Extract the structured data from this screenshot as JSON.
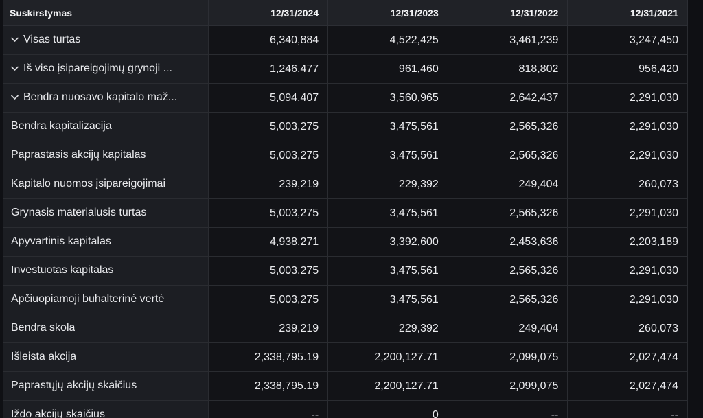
{
  "table": {
    "header": {
      "label": "Suskirstymas",
      "periods": [
        "12/31/2024",
        "12/31/2023",
        "12/31/2022",
        "12/31/2021"
      ]
    },
    "rows": [
      {
        "label": "Visas turtas",
        "expandable": true,
        "values": [
          "6,340,884",
          "4,522,425",
          "3,461,239",
          "3,247,450"
        ]
      },
      {
        "label": "Iš viso įsipareigojimų grynoji ...",
        "expandable": true,
        "values": [
          "1,246,477",
          "961,460",
          "818,802",
          "956,420"
        ]
      },
      {
        "label": "Bendra nuosavo kapitalo maž...",
        "expandable": true,
        "values": [
          "5,094,407",
          "3,560,965",
          "2,642,437",
          "2,291,030"
        ]
      },
      {
        "label": "Bendra kapitalizacija",
        "expandable": false,
        "values": [
          "5,003,275",
          "3,475,561",
          "2,565,326",
          "2,291,030"
        ]
      },
      {
        "label": "Paprastasis akcijų kapitalas",
        "expandable": false,
        "values": [
          "5,003,275",
          "3,475,561",
          "2,565,326",
          "2,291,030"
        ]
      },
      {
        "label": "Kapitalo nuomos įsipareigojimai",
        "expandable": false,
        "values": [
          "239,219",
          "229,392",
          "249,404",
          "260,073"
        ]
      },
      {
        "label": "Grynasis materialusis turtas",
        "expandable": false,
        "values": [
          "5,003,275",
          "3,475,561",
          "2,565,326",
          "2,291,030"
        ]
      },
      {
        "label": "Apyvartinis kapitalas",
        "expandable": false,
        "values": [
          "4,938,271",
          "3,392,600",
          "2,453,636",
          "2,203,189"
        ]
      },
      {
        "label": "Investuotas kapitalas",
        "expandable": false,
        "values": [
          "5,003,275",
          "3,475,561",
          "2,565,326",
          "2,291,030"
        ]
      },
      {
        "label": "Apčiuopiamoji buhalterinė vertė",
        "expandable": false,
        "values": [
          "5,003,275",
          "3,475,561",
          "2,565,326",
          "2,291,030"
        ]
      },
      {
        "label": "Bendra skola",
        "expandable": false,
        "values": [
          "239,219",
          "229,392",
          "249,404",
          "260,073"
        ]
      },
      {
        "label": "Išleista akcija",
        "expandable": false,
        "values": [
          "2,338,795.19",
          "2,200,127.71",
          "2,099,075",
          "2,027,474"
        ]
      },
      {
        "label": "Paprastųjų akcijų skaičius",
        "expandable": false,
        "values": [
          "2,338,795.19",
          "2,200,127.71",
          "2,099,075",
          "2,027,474"
        ]
      },
      {
        "label": "Iždo akcijų skaičius",
        "expandable": false,
        "values": [
          "--",
          "0",
          "--",
          "--"
        ]
      }
    ]
  },
  "colors": {
    "background": "#0f1014",
    "header_bg": "#202227",
    "label_bg": "#1c1e23",
    "cell_bg": "#121317",
    "text": "#e9eaed"
  },
  "icons": {
    "expand": "chevron-down-icon"
  }
}
